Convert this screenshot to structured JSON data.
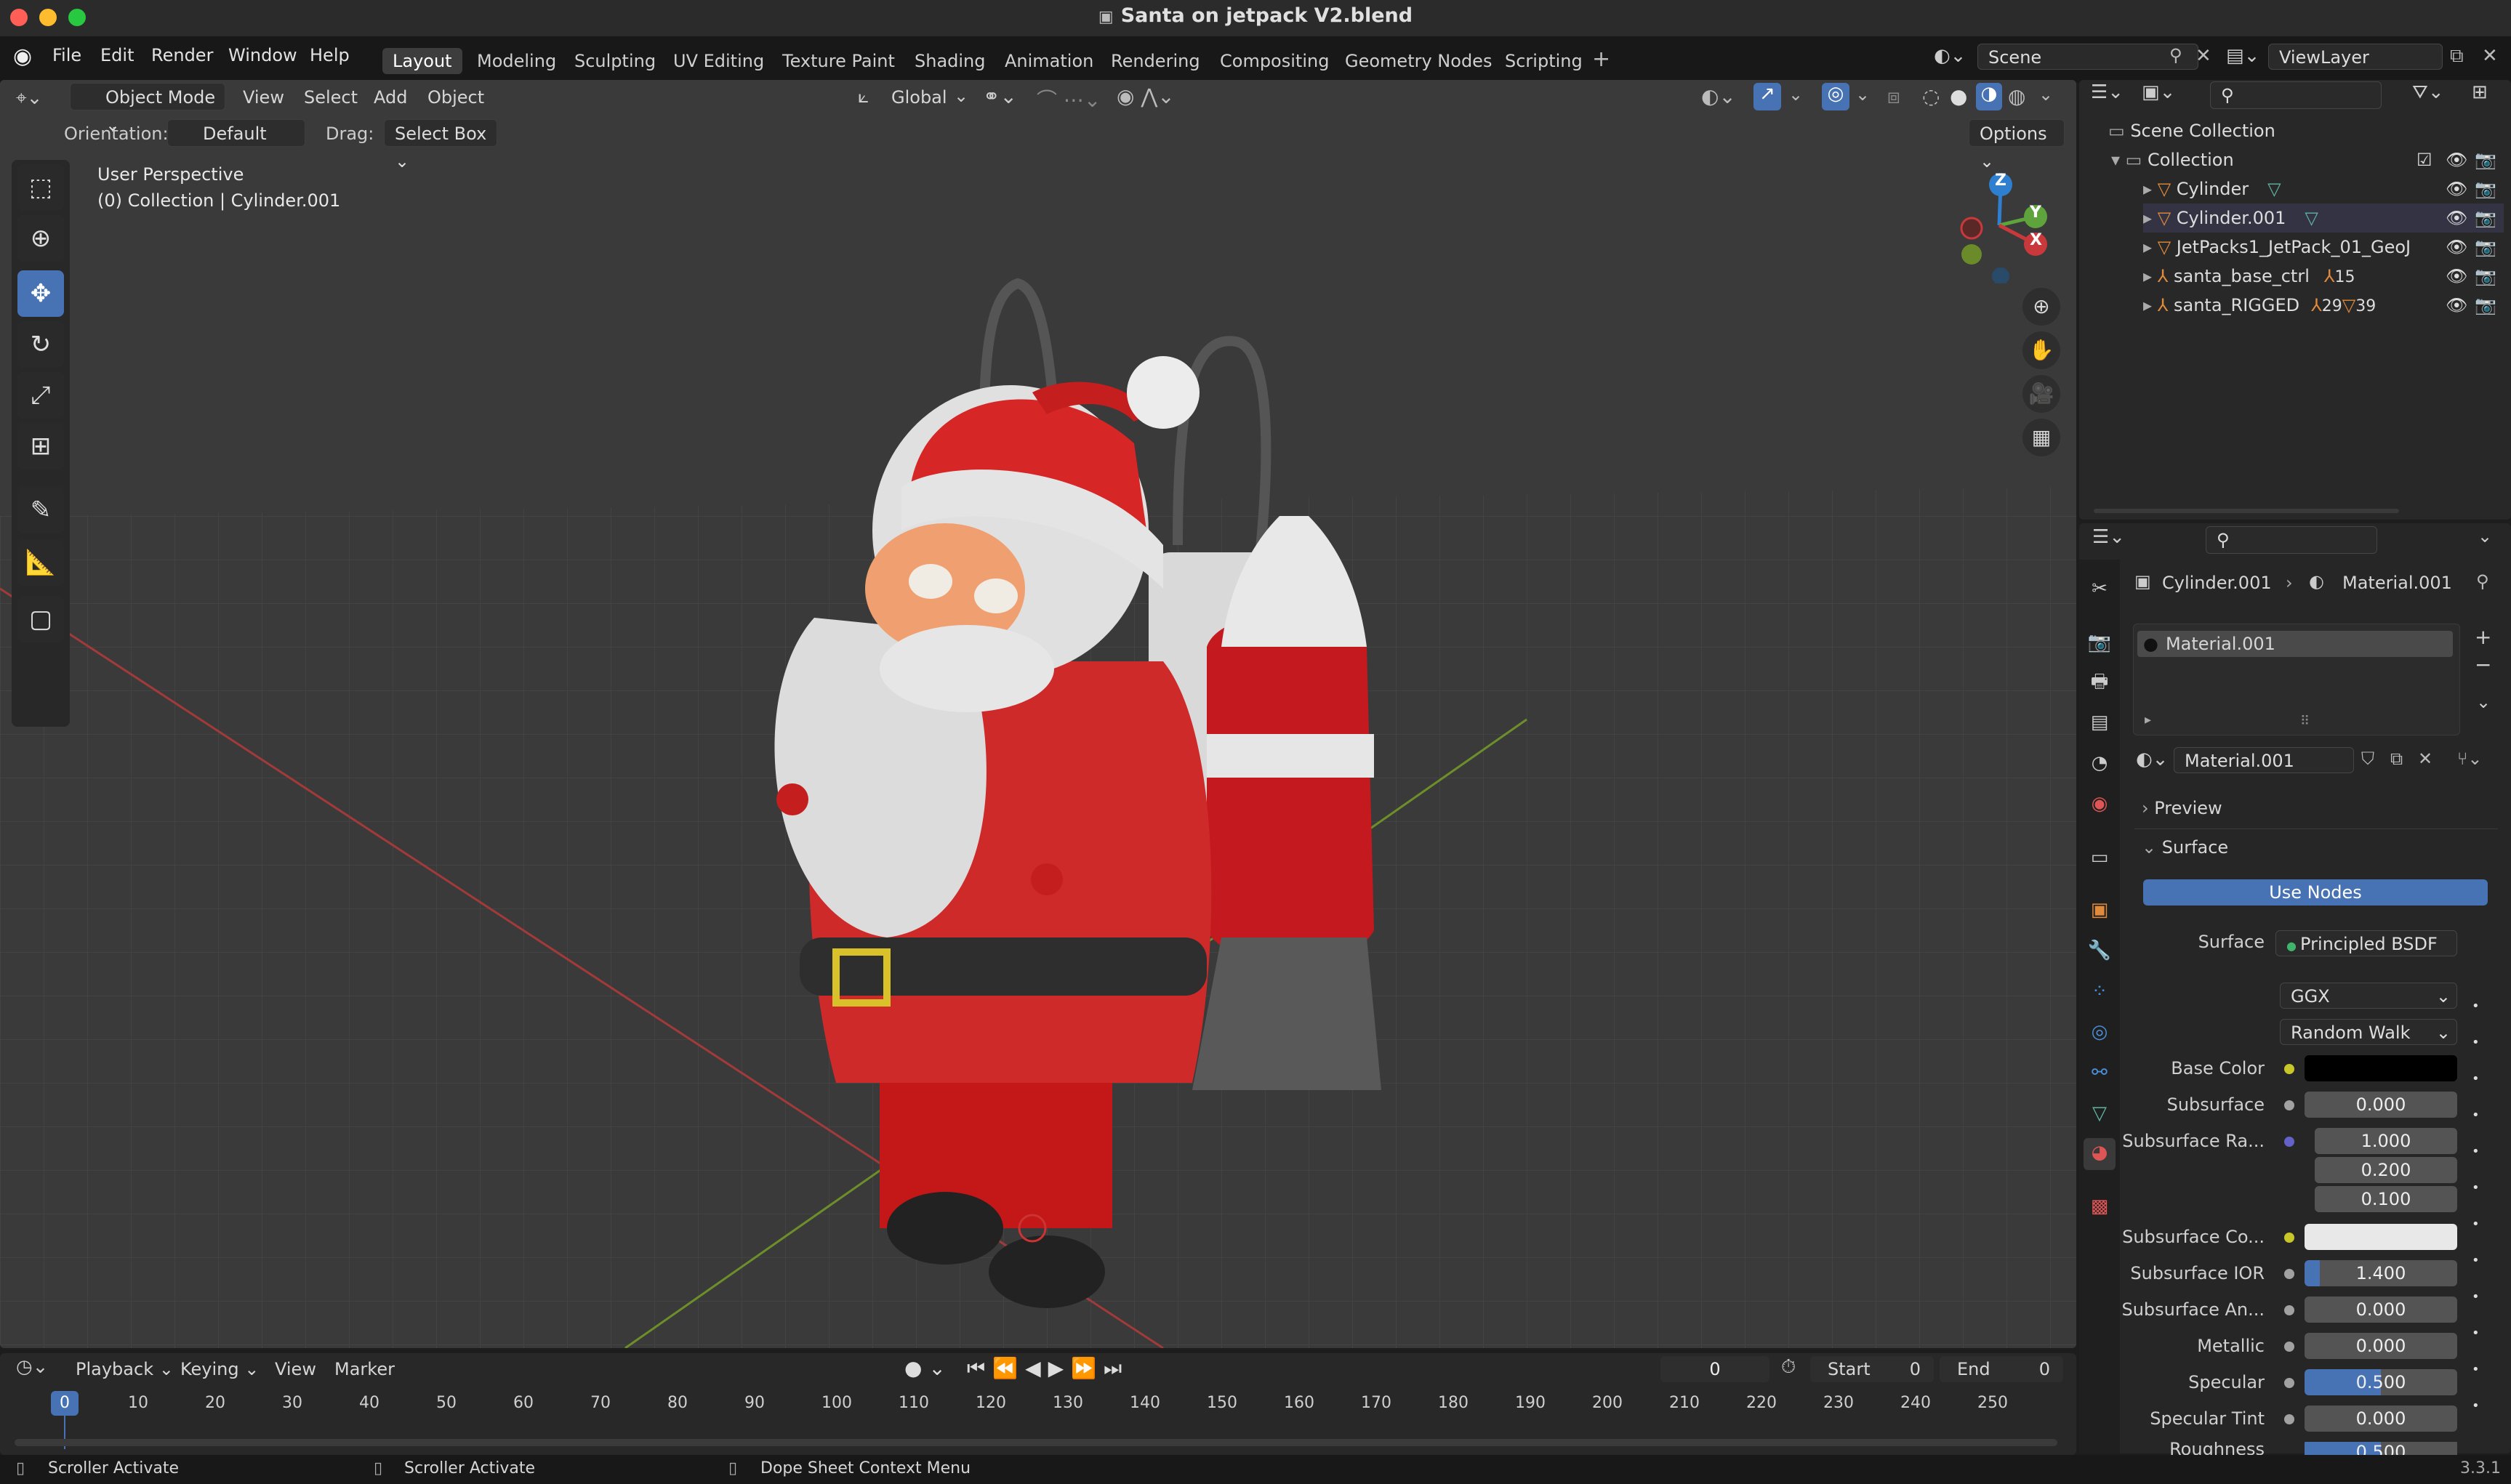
{
  "window": {
    "title": "Santa on jetpack V2.blend"
  },
  "menu": [
    "File",
    "Edit",
    "Render",
    "Window",
    "Help"
  ],
  "workspaces": [
    "Layout",
    "Modeling",
    "Sculpting",
    "UV Editing",
    "Texture Paint",
    "Shading",
    "Animation",
    "Rendering",
    "Compositing",
    "Geometry Nodes",
    "Scripting"
  ],
  "scene": {
    "name": "Scene",
    "view_layer": "ViewLayer"
  },
  "viewport": {
    "mode": "Object Mode",
    "menus": [
      "View",
      "Select",
      "Add",
      "Object"
    ],
    "transform_orientation": "Global",
    "orientation_label": "Orientation:",
    "orientation_value": "Default",
    "drag_label": "Drag:",
    "drag_value": "Select Box",
    "options": "Options",
    "overlay_line1": "User Perspective",
    "overlay_line2": "(0) Collection | Cylinder.001",
    "gizmo": {
      "x": "X",
      "y": "Y",
      "z": "Z"
    }
  },
  "outliner": {
    "root": "Scene Collection",
    "collection": "Collection",
    "items": [
      {
        "name": "Cylinder",
        "badge": ""
      },
      {
        "name": "Cylinder.001",
        "badge": ""
      },
      {
        "name": "JetPacks1_JetPack_01_GeoJ",
        "badge": ""
      },
      {
        "name": "santa_base_ctrl",
        "badge": "15"
      },
      {
        "name": "santa_RIGGED",
        "badge": "29",
        "badge2": "39"
      }
    ]
  },
  "properties": {
    "breadcrumb_object": "Cylinder.001",
    "breadcrumb_material": "Material.001",
    "slot": "Material.001",
    "material_name": "Material.001",
    "sections": {
      "preview": "Preview",
      "surface": "Surface"
    },
    "use_nodes": "Use Nodes",
    "surface_label": "Surface",
    "surface_value": "Principled BSDF",
    "distribution": "GGX",
    "subsurface_method": "Random Walk",
    "rows": [
      {
        "label": "Base Color",
        "value": ""
      },
      {
        "label": "Subsurface",
        "value": "0.000"
      },
      {
        "label": "Subsurface Ra...",
        "value": "1.000"
      },
      {
        "label": "",
        "value": "0.200"
      },
      {
        "label": "",
        "value": "0.100"
      },
      {
        "label": "Subsurface Co...",
        "value": ""
      },
      {
        "label": "Subsurface IOR",
        "value": "1.400"
      },
      {
        "label": "Subsurface An...",
        "value": "0.000"
      },
      {
        "label": "Metallic",
        "value": "0.000"
      },
      {
        "label": "Specular",
        "value": "0.500"
      },
      {
        "label": "Specular Tint",
        "value": "0.000"
      },
      {
        "label": "Roughness",
        "value": "0.500"
      }
    ],
    "colors": {
      "base_color": "#000000",
      "subsurface_color": "#e8e8e8",
      "accent": "#4772b3"
    }
  },
  "timeline": {
    "menus": [
      "Playback",
      "Keying",
      "View",
      "Marker"
    ],
    "current_frame": "0",
    "start_label": "Start",
    "start": "0",
    "end_label": "End",
    "end": "0",
    "ruler": [
      "0",
      "10",
      "20",
      "30",
      "40",
      "50",
      "60",
      "70",
      "80",
      "90",
      "100",
      "110",
      "120",
      "130",
      "140",
      "150",
      "160",
      "170",
      "180",
      "190",
      "200",
      "210",
      "220",
      "230",
      "240",
      "250"
    ]
  },
  "status": {
    "left": "Scroller Activate",
    "middle": "Scroller Activate",
    "right": "Dope Sheet Context Menu",
    "version": "3.3.1"
  }
}
